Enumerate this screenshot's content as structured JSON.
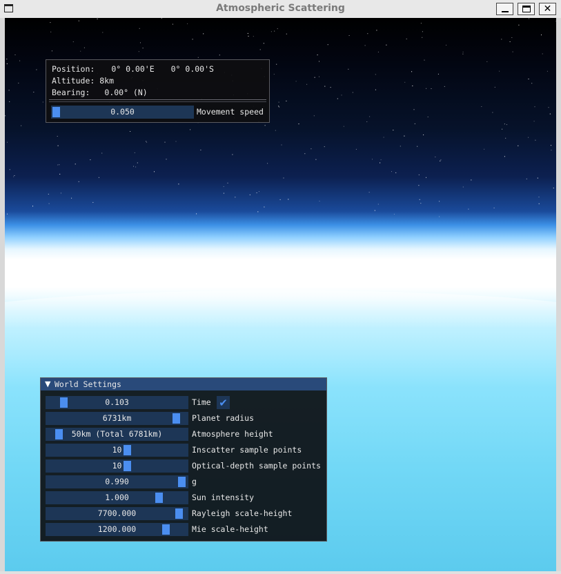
{
  "window": {
    "title": "Atmospheric Scattering",
    "minimize_label": "_",
    "close_label": "✕"
  },
  "nav": {
    "position_label": "Position:",
    "position_lon": "0° 0.00'E",
    "position_lat": "0° 0.00'S",
    "altitude_label": "Altitude:",
    "altitude_value": "8km",
    "bearing_label": "Bearing:",
    "bearing_value": "0.00° (N)",
    "movement_speed": {
      "value": "0.050",
      "label": "Movement speed",
      "fraction": 0.0
    }
  },
  "world_settings": {
    "title": "World Settings",
    "collapse_icon": "triangle-down-icon",
    "rows": [
      {
        "value": "0.103",
        "label": "Time",
        "fraction": 0.1,
        "has_checkbox": true,
        "checked": true
      },
      {
        "value": "6731km",
        "label": "Planet radius",
        "fraction": 0.95
      },
      {
        "value": "50km (Total 6781km)",
        "label": "Atmosphere height",
        "fraction": 0.06
      },
      {
        "value": "10",
        "label": "Inscatter sample points",
        "fraction": 0.58
      },
      {
        "value": "10",
        "label": "Optical-depth sample points",
        "fraction": 0.58
      },
      {
        "value": "0.990",
        "label": "g",
        "fraction": 0.99
      },
      {
        "value": "1.000",
        "label": "Sun intensity",
        "fraction": 0.82
      },
      {
        "value": "7700.000",
        "label": "Rayleigh scale-height",
        "fraction": 0.97
      },
      {
        "value": "1200.000",
        "label": "Mie scale-height",
        "fraction": 0.87
      }
    ]
  },
  "colors": {
    "slider_bg": "#1d3656",
    "slider_grab": "#4b8ef0",
    "header_bg": "#294a7a",
    "sky_top": "#000000",
    "sky_bottom": "#5ccbee"
  }
}
